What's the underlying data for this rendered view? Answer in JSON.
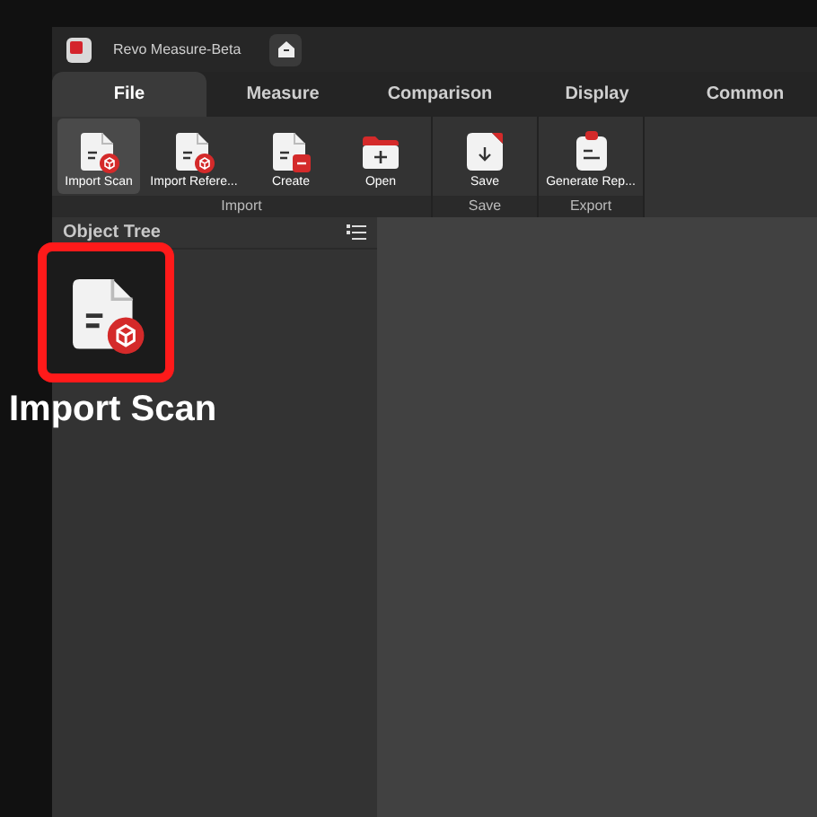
{
  "window": {
    "title": "Revo Measure-Beta"
  },
  "tabs": [
    {
      "label": "File",
      "selected": true
    },
    {
      "label": "Measure",
      "selected": false
    },
    {
      "label": "Comparison",
      "selected": false
    },
    {
      "label": "Display",
      "selected": false
    },
    {
      "label": "Common",
      "selected": false
    }
  ],
  "ribbon": {
    "groups": [
      {
        "label": "Import",
        "buttons": [
          {
            "label": "Import Scan",
            "kind": "scan",
            "selected": true
          },
          {
            "label": "Import Refere...",
            "kind": "reference",
            "selected": false
          },
          {
            "label": "Create",
            "kind": "create",
            "selected": false
          },
          {
            "label": "Open",
            "kind": "open",
            "selected": false
          }
        ]
      },
      {
        "label": "Save",
        "buttons": [
          {
            "label": "Save",
            "kind": "save",
            "selected": false
          }
        ]
      },
      {
        "label": "Export",
        "buttons": [
          {
            "label": "Generate Rep...",
            "kind": "report",
            "selected": false
          }
        ]
      }
    ]
  },
  "object_tree": {
    "title": "Object Tree"
  },
  "callout": {
    "label": "Import Scan",
    "kind": "scan"
  }
}
